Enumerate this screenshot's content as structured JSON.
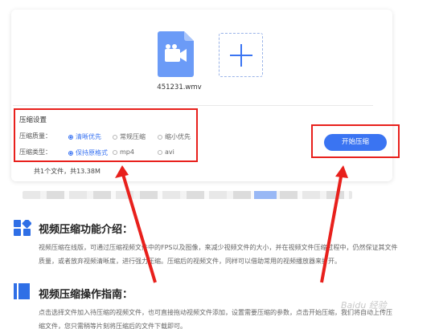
{
  "upload": {
    "file_name": "451231.wmv",
    "file_icon": "video-file-icon",
    "add_icon": "plus-icon"
  },
  "settings": {
    "title": "压缩设置",
    "quality_label": "压缩质量：",
    "quality_options": [
      "清晰优先",
      "常规压缩",
      "缩小优先"
    ],
    "quality_selected": "清晰优先",
    "type_label": "压缩类型：",
    "type_options": [
      "保持原格式",
      "mp4",
      "avi"
    ],
    "type_selected": "保持原格式"
  },
  "summary": "共1个文件，共13.38M",
  "start_button": "开始压缩",
  "section1": {
    "title": "视频压缩功能介绍：",
    "body_line1": "视频压缩在线版，可通过压缩视频文件中的FPS以及图像，来减少视频文件的大小，并在视频文件压缩过程中，仍然保证其文件",
    "body_line2": "质量，或者放弃视频清晰度，进行强力压缩。压缩后的视频文件，同样可以借助常用的视频播放器来打开。"
  },
  "section2": {
    "title": "视频压缩操作指南：",
    "body_line1": "点击选择文件加入待压缩的视频文件，也可直接拖动视频文件添加，设置需要压缩的参数，点击开始压缩，我们将自动上传压",
    "body_line2": "缩文件，您只需稍等片刻将压缩后的文件下载即可。"
  },
  "watermark": "Baidu 经验",
  "colors": {
    "accent": "#3a74f2",
    "highlight_red": "#e8201c",
    "section_icon": "#2f6fe6"
  }
}
